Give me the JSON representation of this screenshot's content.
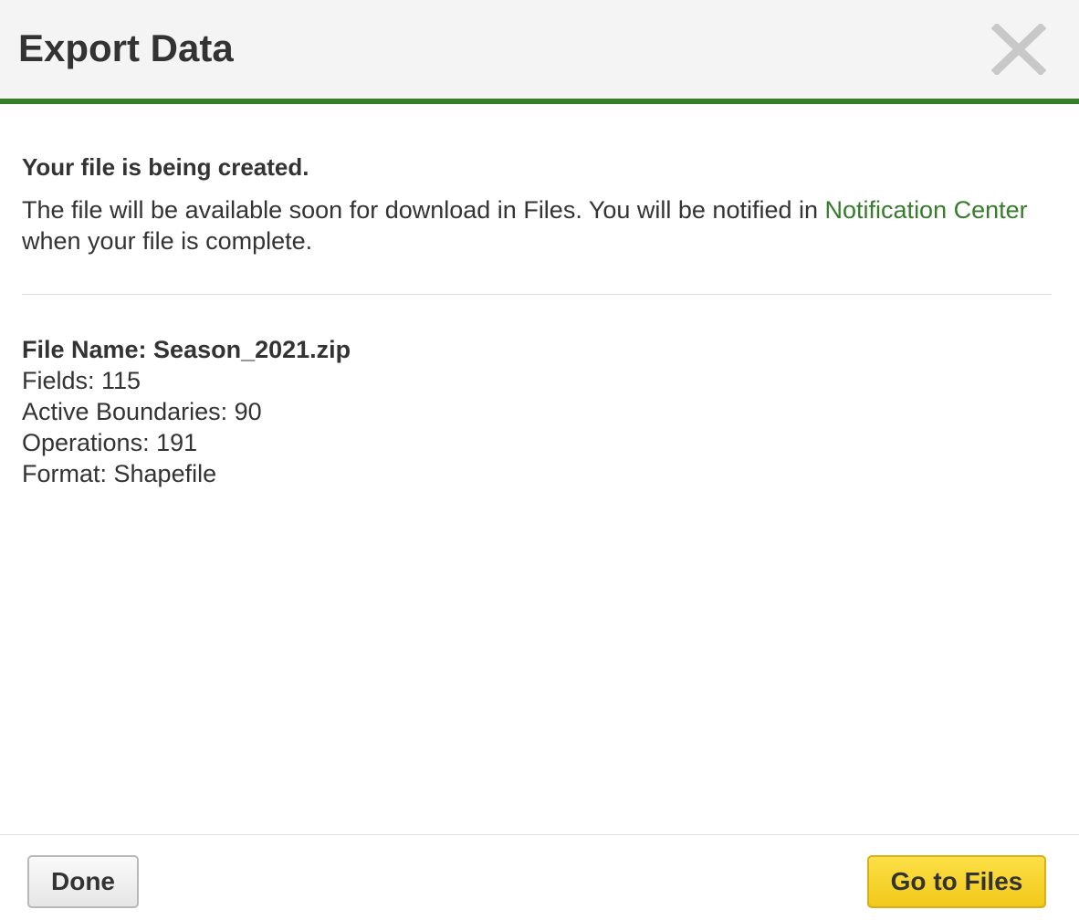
{
  "dialog": {
    "title": "Export Data",
    "close_icon": "close-x-icon"
  },
  "body": {
    "heading": "Your file is being created.",
    "message_before": "The file will be available soon for download in Files. You will be notified in ",
    "link_text": "Notification Center",
    "message_after": " when your file is complete."
  },
  "details": {
    "file_name_label": "File Name: ",
    "file_name_value": "Season_2021.zip",
    "fields": "Fields: 115",
    "active_boundaries": "Active Boundaries: 90",
    "operations": "Operations: 191",
    "format": "Format: Shapefile"
  },
  "footer": {
    "done_label": "Done",
    "go_to_files_label": "Go to Files"
  },
  "colors": {
    "accent_green": "#367c2b",
    "button_yellow": "#f7d22e",
    "text": "#333333"
  }
}
